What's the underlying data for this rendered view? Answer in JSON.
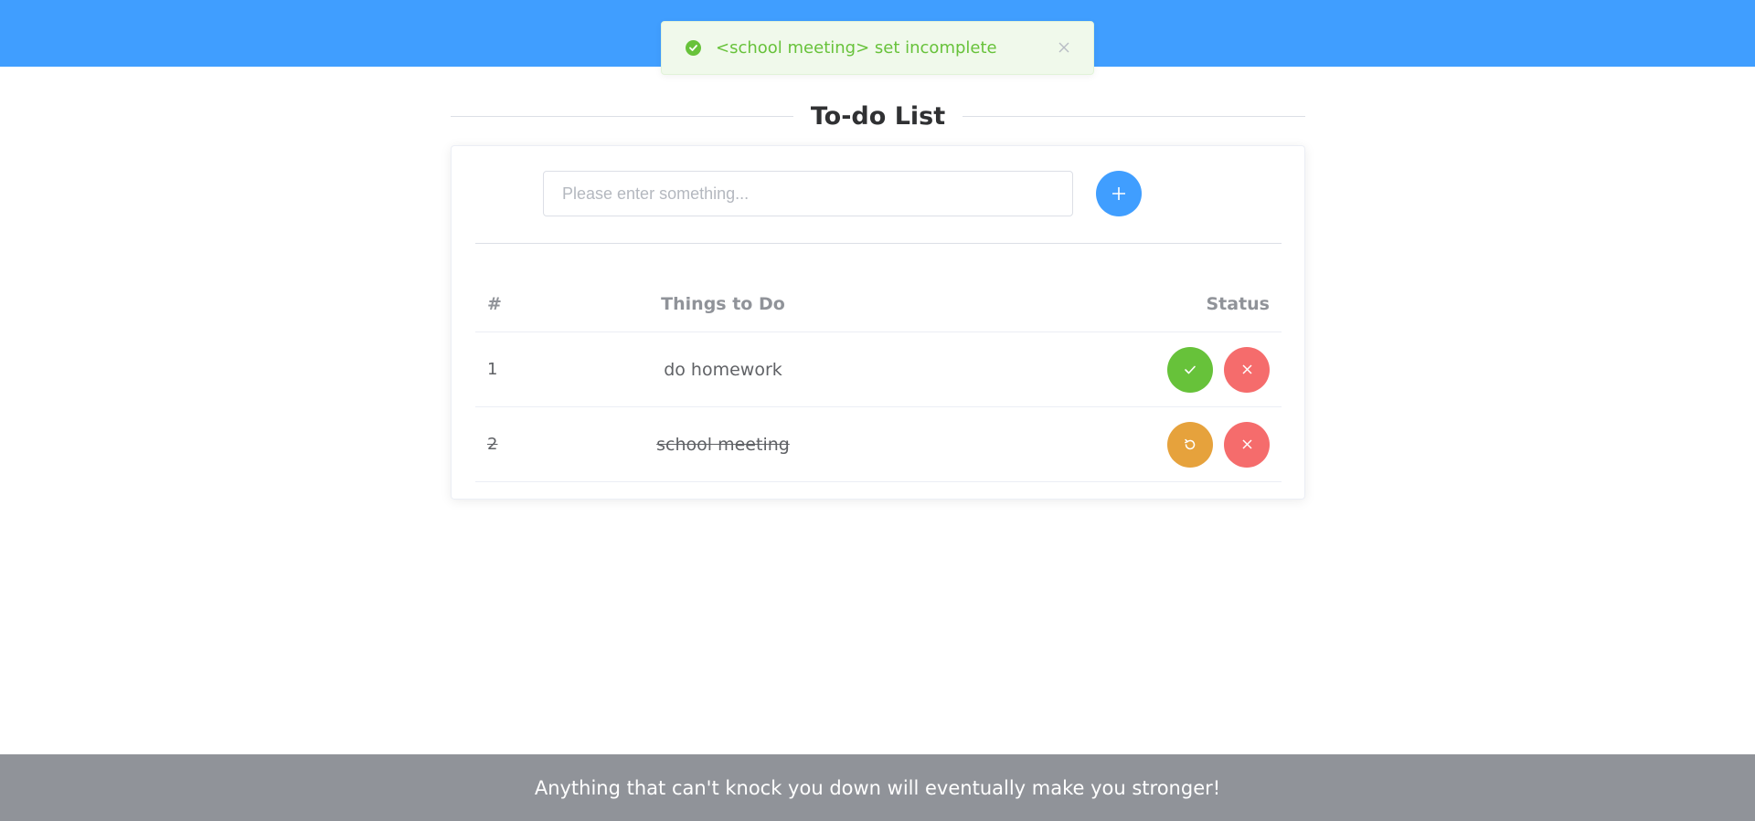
{
  "toast": {
    "message": "<school meeting> set incomplete",
    "icon": "check-circle-icon",
    "close_icon": "close-icon",
    "color": "#67c23a"
  },
  "title": "To-do List",
  "input": {
    "value": "",
    "placeholder": "Please enter something..."
  },
  "add_button": {
    "icon": "plus-icon",
    "color": "#409eff"
  },
  "table": {
    "headers": {
      "num": "#",
      "task": "Things to Do",
      "status": "Status"
    },
    "rows": [
      {
        "num": "1",
        "task": "do homework",
        "completed": false,
        "primary_icon": "check-icon",
        "delete_icon": "close-icon"
      },
      {
        "num": "2",
        "task": "school meeting",
        "completed": true,
        "primary_icon": "refresh-icon",
        "delete_icon": "close-icon"
      }
    ]
  },
  "footer": {
    "text": "Anything that can't knock you down will eventually make you stronger!"
  },
  "colors": {
    "header_bar": "#409eff",
    "success": "#67c23a",
    "warning": "#e6a23c",
    "danger": "#f56c6c",
    "footer_bg": "#909399"
  }
}
